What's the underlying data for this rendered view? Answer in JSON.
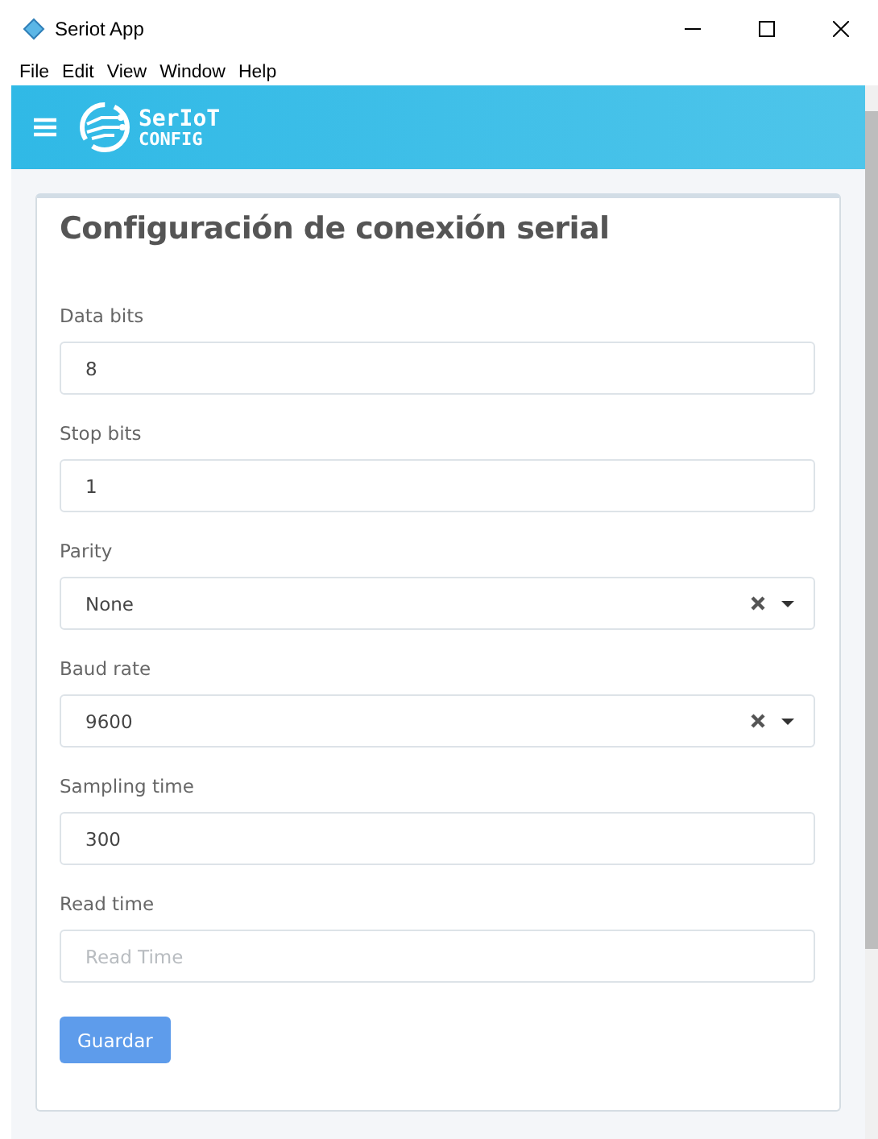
{
  "window": {
    "title": "Seriot App"
  },
  "menu": [
    "File",
    "Edit",
    "View",
    "Window",
    "Help"
  ],
  "header": {
    "logo_top": "SerIoT",
    "logo_bottom": "CONFIG"
  },
  "card": {
    "title": "Configuración de conexión serial",
    "fields": [
      {
        "kind": "text",
        "label": "Data bits",
        "value": "8"
      },
      {
        "kind": "text",
        "label": "Stop bits",
        "value": "1"
      },
      {
        "kind": "select",
        "label": "Parity",
        "value": "None"
      },
      {
        "kind": "select",
        "label": "Baud rate",
        "value": "9600"
      },
      {
        "kind": "text",
        "label": "Sampling time",
        "value": "300"
      },
      {
        "kind": "text",
        "label": "Read time",
        "placeholder": "Read Time"
      }
    ],
    "button": "Guardar"
  }
}
